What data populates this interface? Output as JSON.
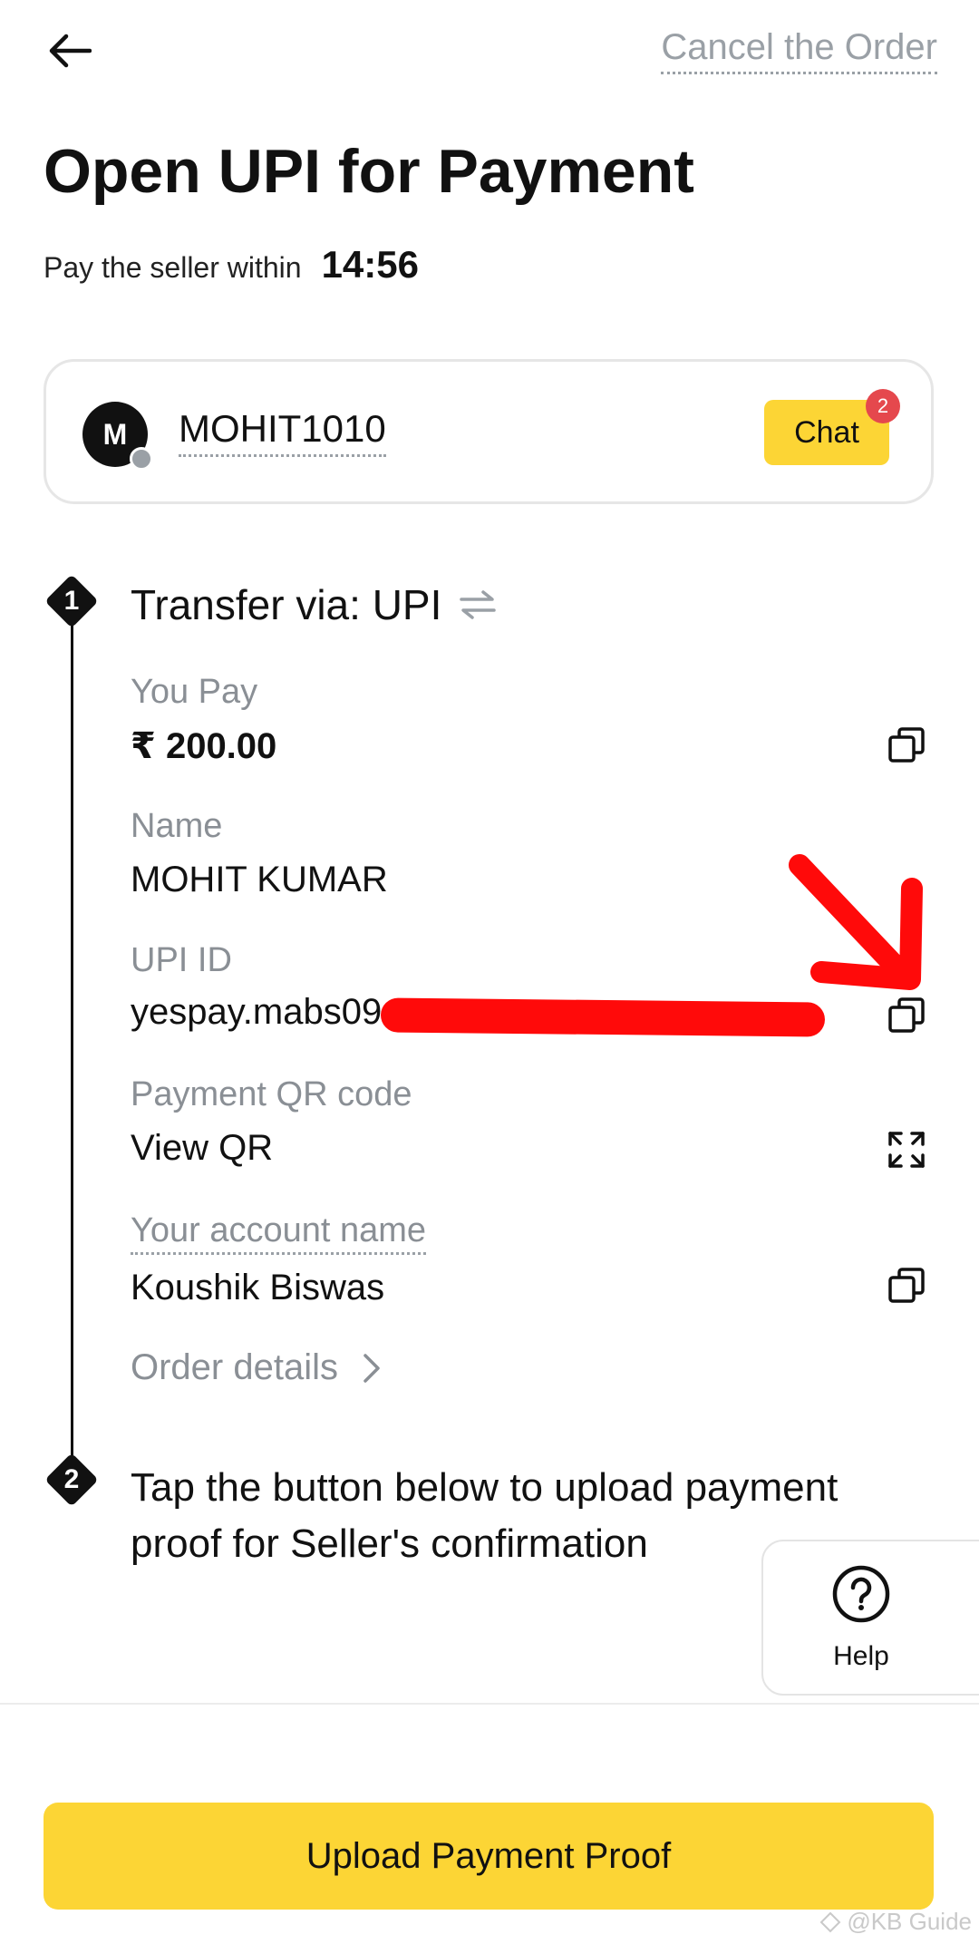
{
  "header": {
    "cancel_label": "Cancel the Order"
  },
  "page": {
    "title": "Open UPI for Payment",
    "timer_label": "Pay the seller within",
    "timer_value": "14:56"
  },
  "seller": {
    "avatar_initial": "M",
    "name": "MOHIT1010",
    "chat_label": "Chat",
    "chat_badge": "2"
  },
  "step1": {
    "number": "1",
    "title": "Transfer via: UPI",
    "fields": [
      {
        "label": "You Pay",
        "value": "₹ 200.00"
      },
      {
        "label": "Name",
        "value": "MOHIT KUMAR"
      },
      {
        "label": "UPI ID",
        "value": "yespay.mabs09"
      },
      {
        "label": "Payment QR code",
        "value": "View QR"
      },
      {
        "label": "Your account name",
        "value": "Koushik Biswas"
      }
    ],
    "order_details_label": "Order details"
  },
  "step2": {
    "number": "2",
    "title": "Tap the button below to upload payment proof for Seller's confirmation"
  },
  "help": {
    "label": "Help"
  },
  "footer": {
    "upload_label": "Upload Payment Proof",
    "watermark": "@KB Guide"
  },
  "colors": {
    "accent": "#fcd535",
    "badge": "#e5484d",
    "muted_text": "#8a8f95",
    "annotation_red": "#ff0a0a"
  },
  "icons": {
    "back": "arrow-left-icon",
    "swap": "swap-arrows-icon",
    "copy": "copy-icon",
    "expand": "expand-icon",
    "chevron": "chevron-right-icon",
    "help": "question-circle-icon"
  }
}
